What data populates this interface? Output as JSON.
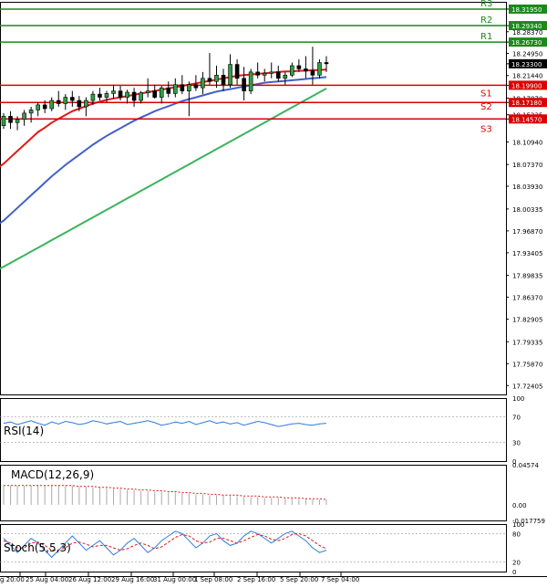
{
  "chart_data": {
    "type": "candlestick",
    "main": {
      "ylim": [
        17.71,
        18.331
      ],
      "price_ticks": [
        "18.31950",
        "18.29340",
        "18.28370",
        "18.26730",
        "18.24950",
        "18.23300",
        "18.21440",
        "18.19900",
        "18.17870",
        "18.17180",
        "18.15235",
        "18.14570",
        "18.10940",
        "18.07370",
        "18.03930",
        "18.00335",
        "17.96870",
        "17.93405",
        "17.89835",
        "17.86370",
        "17.82905",
        "17.79335",
        "17.75870",
        "17.72405"
      ],
      "current_price": "18.23300",
      "levels": [
        {
          "name": "R3",
          "value": 18.3195,
          "label": "18.31950",
          "color": "#1a8a1a"
        },
        {
          "name": "R2",
          "value": 18.2934,
          "label": "18.29340",
          "color": "#1a8a1a"
        },
        {
          "name": "R1",
          "value": 18.2673,
          "label": "18.26730",
          "color": "#1a8a1a"
        },
        {
          "name": "",
          "value": 18.199,
          "label": "18.19900",
          "color": "#dd0000"
        },
        {
          "name": "S1",
          "value": 18.1718,
          "label": "18.17180",
          "color": "#dd0000"
        },
        {
          "name": "S2",
          "value": 18.1718,
          "label": "",
          "color": "#dd0000"
        },
        {
          "name": "S3",
          "value": 18.1457,
          "label": "18.14570",
          "color": "#dd0000"
        }
      ],
      "candles": [
        [
          18.135,
          18.155,
          18.13,
          18.15
        ],
        [
          18.15,
          18.158,
          18.13,
          18.14
        ],
        [
          18.14,
          18.15,
          18.128,
          18.145
        ],
        [
          18.145,
          18.16,
          18.135,
          18.155
        ],
        [
          18.155,
          18.165,
          18.14,
          18.16
        ],
        [
          18.16,
          18.172,
          18.15,
          18.168
        ],
        [
          18.168,
          18.175,
          18.155,
          18.162
        ],
        [
          18.162,
          18.18,
          18.158,
          18.175
        ],
        [
          18.175,
          18.19,
          18.165,
          18.17
        ],
        [
          18.17,
          18.185,
          18.16,
          18.18
        ],
        [
          18.18,
          18.19,
          18.165,
          18.175
        ],
        [
          18.175,
          18.182,
          18.158,
          18.165
        ],
        [
          18.165,
          18.18,
          18.15,
          18.175
        ],
        [
          18.175,
          18.19,
          18.168,
          18.185
        ],
        [
          18.185,
          18.195,
          18.175,
          18.18
        ],
        [
          18.18,
          18.19,
          18.172,
          18.186
        ],
        [
          18.186,
          18.2,
          18.178,
          18.19
        ],
        [
          18.19,
          18.198,
          18.175,
          18.18
        ],
        [
          18.18,
          18.192,
          18.17,
          18.188
        ],
        [
          18.188,
          18.195,
          18.165,
          18.175
        ],
        [
          18.175,
          18.19,
          18.17,
          18.187
        ],
        [
          18.187,
          18.21,
          18.18,
          18.19
        ],
        [
          18.19,
          18.2,
          18.178,
          18.18
        ],
        [
          18.18,
          18.198,
          18.17,
          18.195
        ],
        [
          18.195,
          18.205,
          18.18,
          18.186
        ],
        [
          18.186,
          18.21,
          18.18,
          18.2
        ],
        [
          18.2,
          18.215,
          18.185,
          18.19
        ],
        [
          18.19,
          18.205,
          18.15,
          18.2
        ],
        [
          18.2,
          18.215,
          18.19,
          18.195
        ],
        [
          18.195,
          18.22,
          18.185,
          18.21
        ],
        [
          18.21,
          18.25,
          18.2,
          18.205
        ],
        [
          18.205,
          18.23,
          18.195,
          18.215
        ],
        [
          18.215,
          18.225,
          18.19,
          18.2
        ],
        [
          18.2,
          18.248,
          18.195,
          18.232
        ],
        [
          18.232,
          18.24,
          18.2,
          18.21
        ],
        [
          18.21,
          18.228,
          18.175,
          18.19
        ],
        [
          18.19,
          18.225,
          18.185,
          18.22
        ],
        [
          18.22,
          18.235,
          18.21,
          18.215
        ],
        [
          18.215,
          18.225,
          18.205,
          18.218
        ],
        [
          18.218,
          18.235,
          18.21,
          18.22
        ],
        [
          18.22,
          18.23,
          18.205,
          18.21
        ],
        [
          18.21,
          18.22,
          18.2,
          18.215
        ],
        [
          18.215,
          18.235,
          18.212,
          18.23
        ],
        [
          18.23,
          18.24,
          18.22,
          18.225
        ],
        [
          18.225,
          18.245,
          18.21,
          18.222
        ],
        [
          18.222,
          18.26,
          18.2,
          18.215
        ],
        [
          18.215,
          18.24,
          18.21,
          18.235
        ],
        [
          18.235,
          18.245,
          18.22,
          18.233
        ]
      ],
      "ma_red": [
        18.075,
        18.085,
        18.095,
        18.105,
        18.115,
        18.125,
        18.132,
        18.14,
        18.146,
        18.152,
        18.158,
        18.162,
        18.166,
        18.17,
        18.173,
        18.176,
        18.178,
        18.18,
        18.182,
        18.184,
        18.186,
        18.188,
        18.19,
        18.192,
        18.194,
        18.196,
        18.198,
        18.2,
        18.202,
        18.204,
        18.206,
        18.208,
        18.21,
        18.212,
        18.214,
        18.215,
        18.216,
        18.217,
        18.218,
        18.219,
        18.22,
        18.221,
        18.221,
        18.222,
        18.222,
        18.223,
        18.223,
        18.224
      ],
      "ma_blue": [
        17.985,
        17.995,
        18.005,
        18.015,
        18.025,
        18.035,
        18.045,
        18.055,
        18.064,
        18.073,
        18.081,
        18.089,
        18.097,
        18.105,
        18.112,
        18.119,
        18.125,
        18.131,
        18.137,
        18.143,
        18.148,
        18.153,
        18.158,
        18.162,
        18.166,
        18.17,
        18.174,
        18.177,
        18.18,
        18.183,
        18.186,
        18.189,
        18.191,
        18.193,
        18.195,
        18.197,
        18.199,
        18.201,
        18.203,
        18.204,
        18.205,
        18.206,
        18.207,
        18.208,
        18.209,
        18.21,
        18.211,
        18.212
      ],
      "ma_green": [
        17.912,
        17.918,
        17.924,
        17.93,
        17.936,
        17.942,
        17.948,
        17.954,
        17.96,
        17.966,
        17.972,
        17.978,
        17.984,
        17.99,
        17.996,
        18.002,
        18.008,
        18.014,
        18.02,
        18.026,
        18.032,
        18.038,
        18.044,
        18.05,
        18.056,
        18.062,
        18.068,
        18.074,
        18.08,
        18.086,
        18.092,
        18.098,
        18.104,
        18.11,
        18.116,
        18.122,
        18.128,
        18.134,
        18.14,
        18.146,
        18.152,
        18.158,
        18.164,
        18.17,
        18.176,
        18.182,
        18.188,
        18.194
      ]
    },
    "rsi": {
      "label": "RSI(14)",
      "ticks": [
        "100",
        "70",
        "30",
        "0"
      ],
      "values": [
        60,
        62,
        58,
        61,
        64,
        60,
        57,
        62,
        59,
        63,
        61,
        58,
        60,
        64,
        62,
        59,
        61,
        63,
        58,
        60,
        62,
        64,
        61,
        57,
        59,
        62,
        60,
        63,
        58,
        61,
        64,
        60,
        62,
        59,
        61,
        57,
        60,
        63,
        61,
        58,
        55,
        57,
        59,
        60,
        58,
        57,
        59,
        60
      ]
    },
    "macd": {
      "label": "MACD(12,26,9)",
      "ticks": [
        "0.04574",
        "0.00",
        "-0.017759"
      ],
      "ylim": [
        -0.0178,
        0.0457
      ],
      "hist": [
        0.022,
        0.022,
        0.022,
        0.022,
        0.022,
        0.022,
        0.022,
        0.022,
        0.022,
        0.022,
        0.022,
        0.021,
        0.021,
        0.02,
        0.02,
        0.019,
        0.018,
        0.018,
        0.017,
        0.017,
        0.016,
        0.016,
        0.015,
        0.015,
        0.014,
        0.014,
        0.013,
        0.013,
        0.012,
        0.012,
        0.011,
        0.011,
        0.011,
        0.01,
        0.01,
        0.009,
        0.009,
        0.009,
        0.008,
        0.008,
        0.008,
        0.007,
        0.007,
        0.007,
        0.006,
        0.006,
        0.006,
        0.006
      ],
      "signal": [
        0.022,
        0.022,
        0.022,
        0.022,
        0.022,
        0.022,
        0.022,
        0.022,
        0.022,
        0.022,
        0.022,
        0.021,
        0.021,
        0.021,
        0.02,
        0.02,
        0.019,
        0.019,
        0.018,
        0.018,
        0.017,
        0.017,
        0.016,
        0.016,
        0.015,
        0.015,
        0.014,
        0.014,
        0.013,
        0.013,
        0.012,
        0.012,
        0.011,
        0.011,
        0.011,
        0.01,
        0.01,
        0.01,
        0.009,
        0.009,
        0.009,
        0.008,
        0.008,
        0.008,
        0.007,
        0.007,
        0.007,
        0.006
      ]
    },
    "stoch": {
      "label": "Stoch(5,5,3)",
      "ticks": [
        "100",
        "80",
        "20",
        "0"
      ],
      "k": [
        70,
        55,
        40,
        55,
        70,
        60,
        45,
        30,
        45,
        60,
        75,
        60,
        45,
        55,
        65,
        50,
        35,
        45,
        60,
        70,
        55,
        40,
        50,
        65,
        75,
        85,
        80,
        65,
        50,
        60,
        75,
        80,
        65,
        55,
        60,
        75,
        85,
        80,
        70,
        60,
        70,
        80,
        85,
        75,
        65,
        50,
        40,
        45
      ],
      "d": [
        65,
        60,
        50,
        50,
        60,
        62,
        55,
        45,
        45,
        50,
        60,
        62,
        58,
        52,
        55,
        55,
        50,
        45,
        48,
        55,
        60,
        55,
        48,
        52,
        62,
        72,
        78,
        75,
        65,
        60,
        62,
        70,
        70,
        65,
        60,
        65,
        72,
        78,
        75,
        68,
        65,
        70,
        78,
        80,
        75,
        65,
        55,
        48
      ]
    },
    "x_ticks": [
      "g 20:00",
      "25 Aug 04:00",
      "26 Aug 12:00",
      "29 Aug 16:00",
      "31 Aug 00:00",
      "1 Sep 08:00",
      "2 Sep 16:00",
      "5 Sep 20:00",
      "7 Sep 04:00"
    ]
  }
}
